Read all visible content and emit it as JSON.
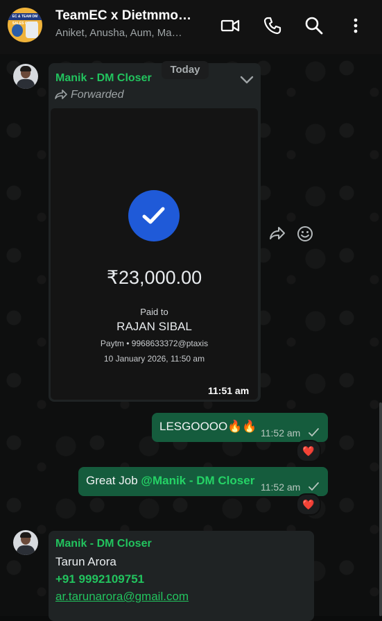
{
  "header": {
    "title": "TeamEC x Dietmmo…",
    "subtitle": "Aniket, Anusha, Aum, Ma…",
    "avatar_text": "EC & TEAM DM SALES GROUP"
  },
  "date_divider": "Today",
  "messages": [
    {
      "sender": "Manik - DM Closer",
      "forwarded_label": "Forwarded",
      "payment": {
        "amount": "₹23,000.00",
        "paid_to_label": "Paid to",
        "payee": "RAJAN SIBAL",
        "upi": "Paytm • 9968633372@ptaxis",
        "date": "10 January 2026, 11:50 am"
      },
      "time": "11:51 am"
    },
    {
      "text": "LESGOOOO🔥🔥",
      "time": "11:52 am",
      "reaction": "❤️"
    },
    {
      "text_prefix": "Great Job ",
      "mention": "@Manik - DM Closer",
      "time": "11:52 am",
      "reaction": "❤️"
    },
    {
      "sender": "Manik - DM Closer",
      "contact_name": "Tarun Arora",
      "phone": "+91 9992109751",
      "email": "ar.tarunarora@gmail.com"
    }
  ],
  "icons": {
    "video": "video-call-icon",
    "voice": "voice-call-icon",
    "search": "search-icon",
    "menu": "more-vert-icon"
  },
  "colors": {
    "accent_green": "#22c35e",
    "outgoing_bubble": "#155c3d",
    "incoming_bubble": "#1f2324",
    "check_blue": "#1f5ad8"
  }
}
